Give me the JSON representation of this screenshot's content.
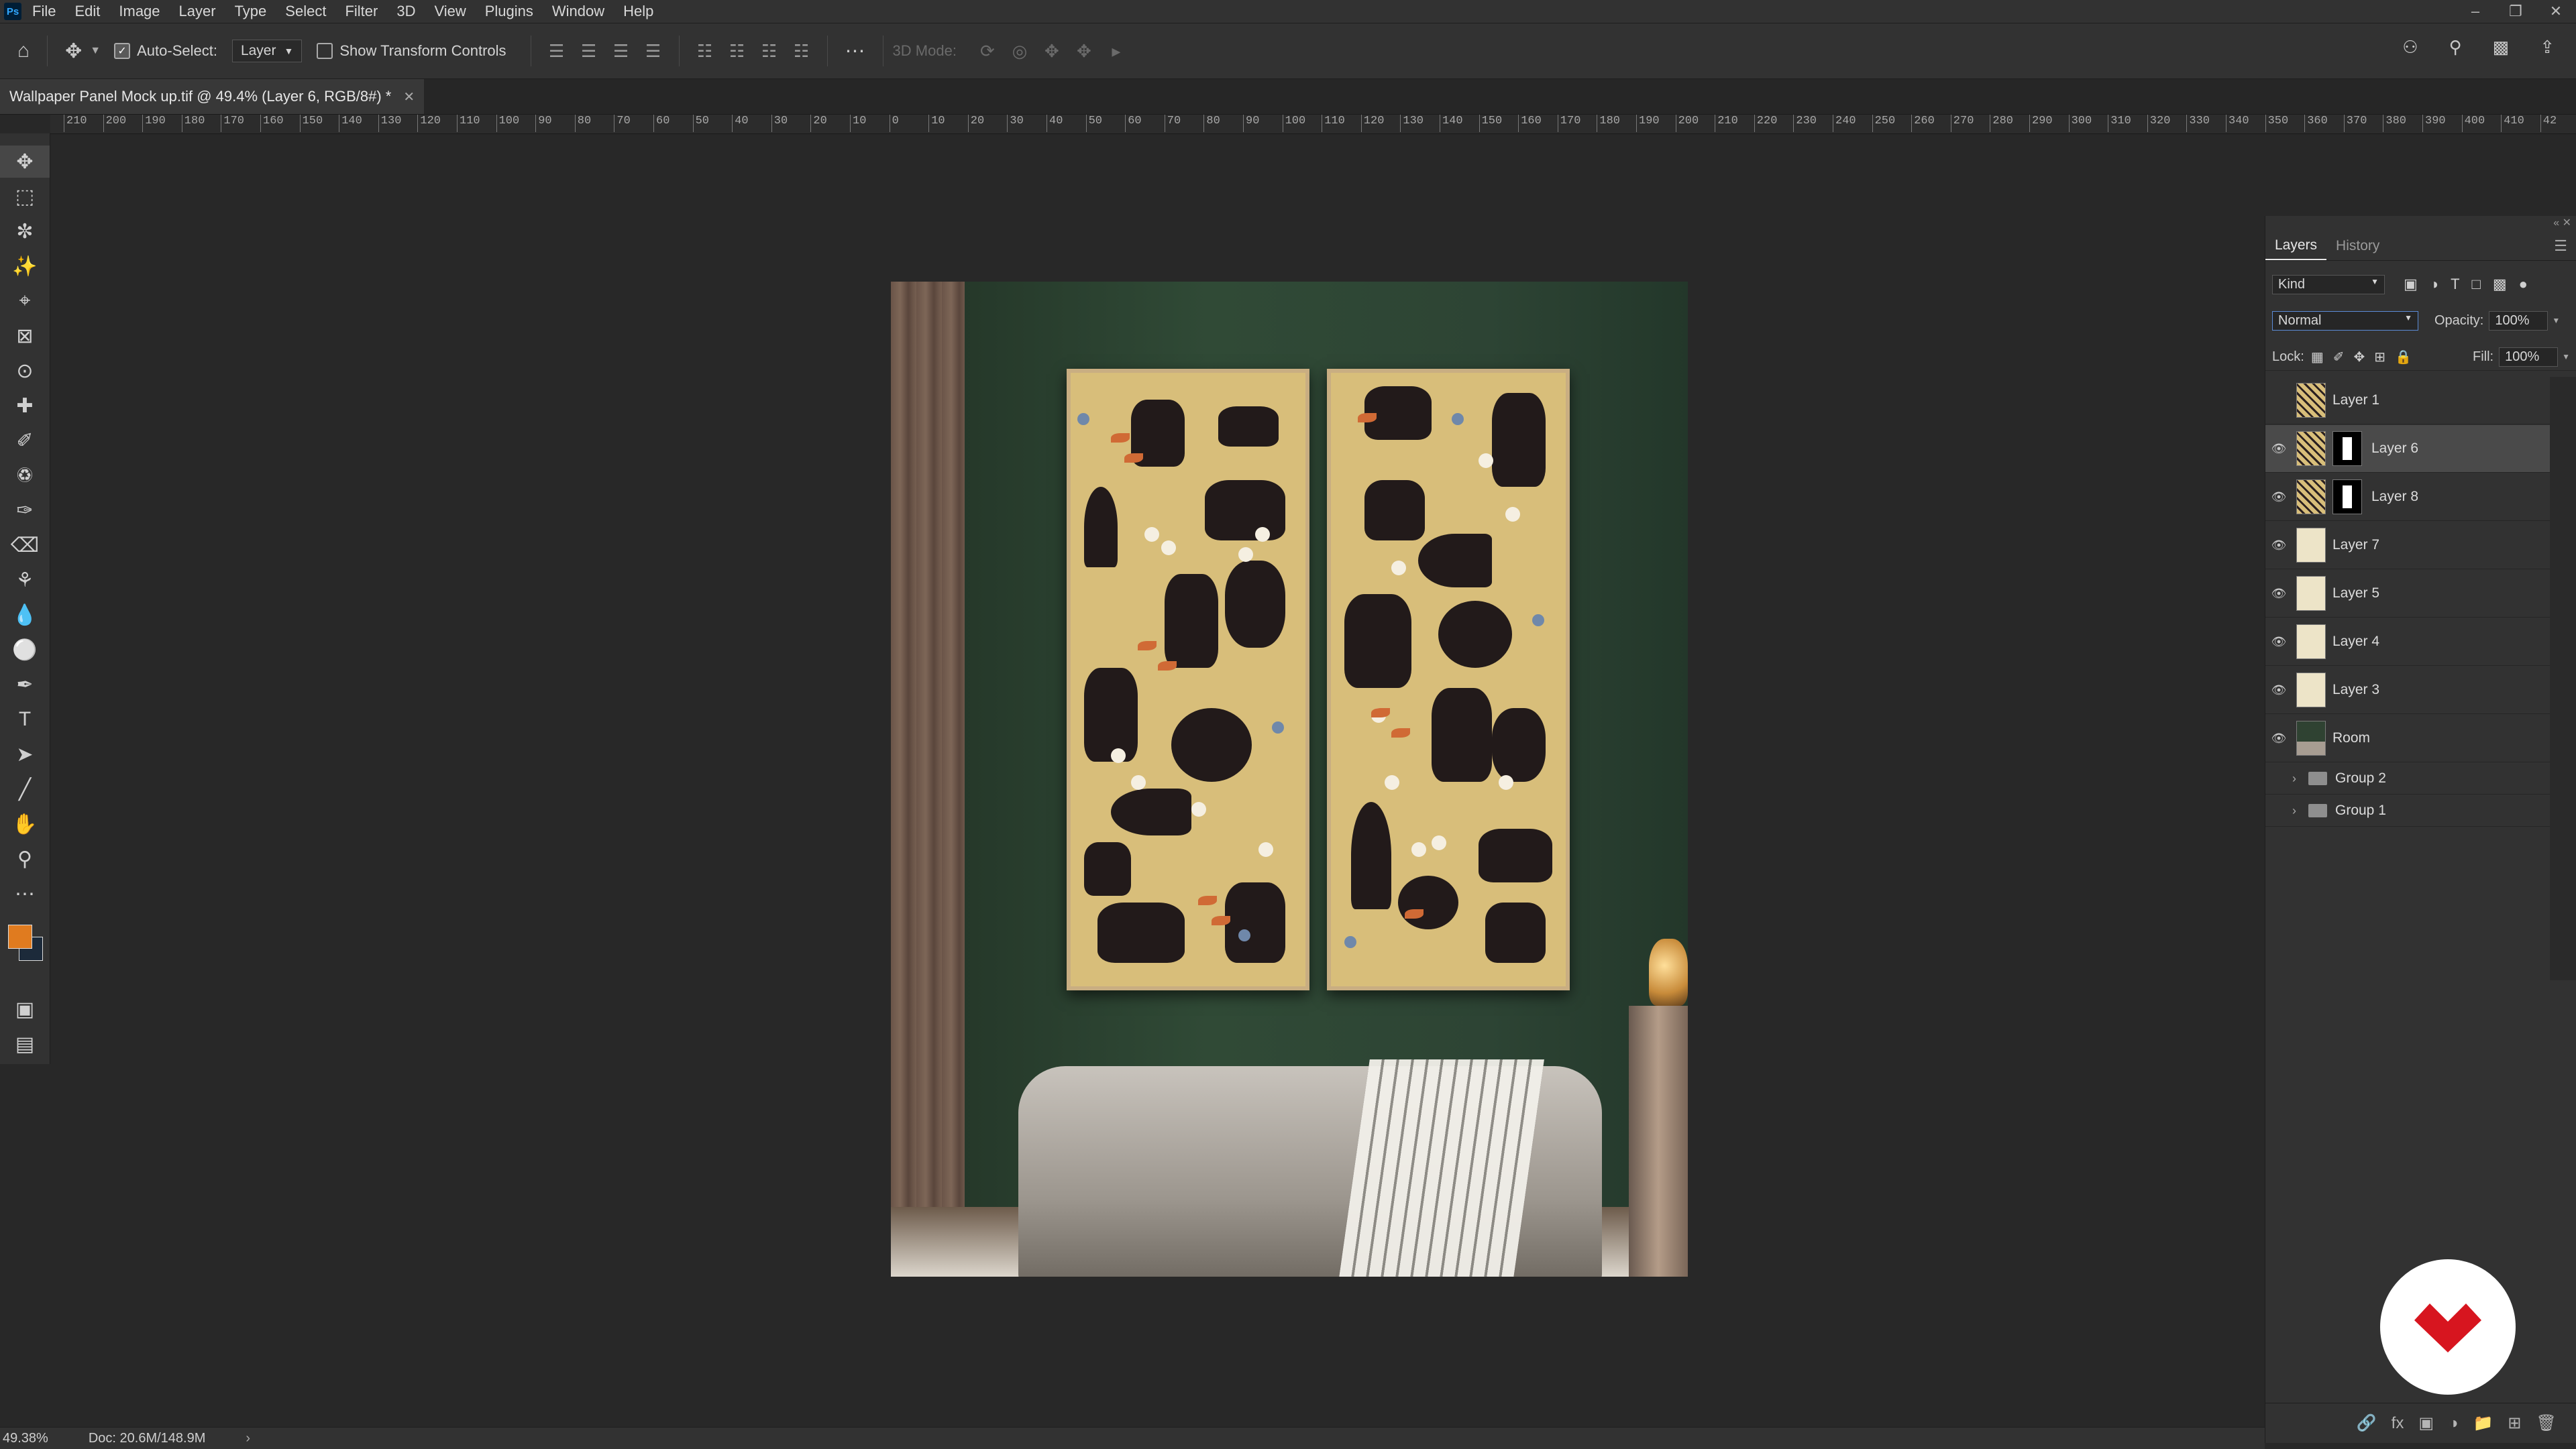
{
  "menubar": {
    "items": [
      "File",
      "Edit",
      "Image",
      "Layer",
      "Type",
      "Select",
      "Filter",
      "3D",
      "View",
      "Plugins",
      "Window",
      "Help"
    ]
  },
  "options": {
    "auto_select_label": "Auto-Select:",
    "auto_select_target": "Layer",
    "show_transform_label": "Show Transform Controls",
    "mode_3d_label": "3D Mode:"
  },
  "document": {
    "tab_title": "Wallpaper Panel Mock up.tif @ 49.4% (Layer 6, RGB/8#) *"
  },
  "ruler": {
    "ticks": [
      "210",
      "200",
      "190",
      "180",
      "170",
      "160",
      "150",
      "140",
      "130",
      "120",
      "110",
      "100",
      "90",
      "80",
      "70",
      "60",
      "50",
      "40",
      "30",
      "20",
      "10",
      "0",
      "10",
      "20",
      "30",
      "40",
      "50",
      "60",
      "70",
      "80",
      "90",
      "100",
      "110",
      "120",
      "130",
      "140",
      "150",
      "160",
      "170",
      "180",
      "190",
      "200",
      "210",
      "220",
      "230",
      "240",
      "250",
      "260",
      "270",
      "280",
      "290",
      "300",
      "310",
      "320",
      "330",
      "340",
      "350",
      "360",
      "370",
      "380",
      "390",
      "400",
      "410",
      "42"
    ]
  },
  "panels": {
    "tabs": {
      "layers": "Layers",
      "history": "History"
    },
    "filter_kind": "Kind",
    "blend_mode": "Normal",
    "opacity_label": "Opacity:",
    "opacity_value": "100%",
    "lock_label": "Lock:",
    "fill_label": "Fill:",
    "fill_value": "100%",
    "layers": [
      {
        "name": "Layer 1",
        "visible": false,
        "thumb": "pattern",
        "mask": false,
        "selected": false
      },
      {
        "name": "Layer 6",
        "visible": true,
        "thumb": "pattern",
        "mask": true,
        "selected": true
      },
      {
        "name": "Layer 8",
        "visible": true,
        "thumb": "pattern",
        "mask": true,
        "selected": false
      },
      {
        "name": "Layer 7",
        "visible": true,
        "thumb": "blank",
        "mask": false,
        "selected": false
      },
      {
        "name": "Layer 5",
        "visible": true,
        "thumb": "blank",
        "mask": false,
        "selected": false
      },
      {
        "name": "Layer 4",
        "visible": true,
        "thumb": "blank",
        "mask": false,
        "selected": false
      },
      {
        "name": "Layer 3",
        "visible": true,
        "thumb": "blank",
        "mask": false,
        "selected": false
      },
      {
        "name": "Room",
        "visible": true,
        "thumb": "room",
        "mask": false,
        "selected": false
      }
    ],
    "groups": [
      "Group 2",
      "Group 1"
    ]
  },
  "status": {
    "zoom": "49.38%",
    "doc": "Doc: 20.6M/148.9M"
  },
  "colors": {
    "foreground": "#e07b1f",
    "background": "#1c2a3a",
    "watermark": "#d7151f"
  }
}
